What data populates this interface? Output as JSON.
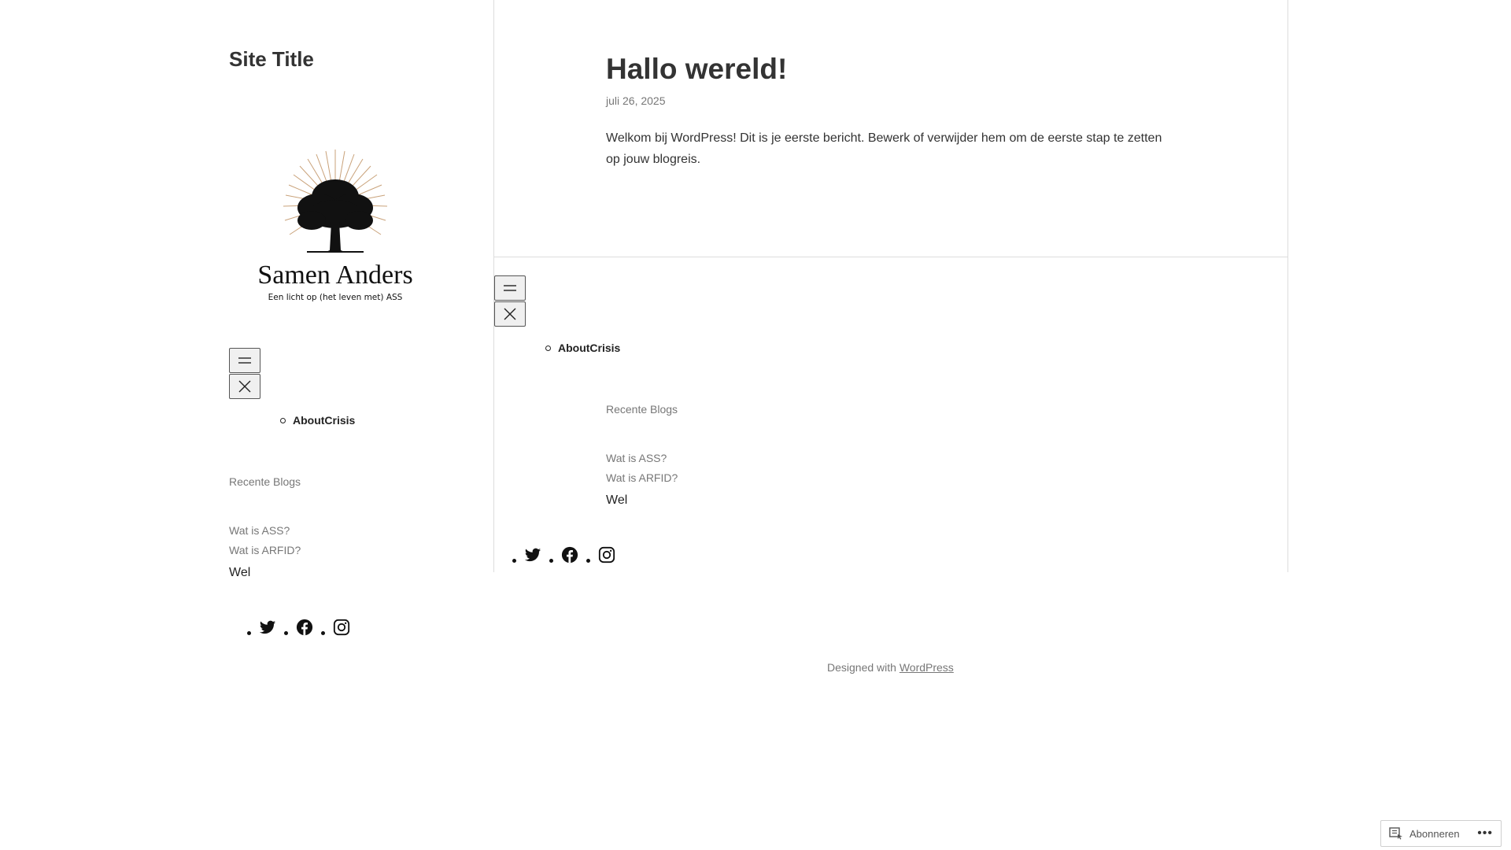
{
  "site": {
    "title": "Site Title"
  },
  "logo": {
    "name": "Samen Anders",
    "tagline": "Een licht op (het leven met) ASS"
  },
  "menu": {
    "open_icon": "hamburger-icon",
    "close_icon": "close-icon",
    "items": [
      {
        "label": "AboutCrisis"
      }
    ]
  },
  "widgets": {
    "recent_title": "Recente Blogs",
    "recent_posts": [
      {
        "label": "Wat is ASS?"
      },
      {
        "label": "Wat is ARFID?"
      }
    ],
    "text": "Wel"
  },
  "social": {
    "icons": [
      "twitter-icon",
      "facebook-icon",
      "instagram-icon"
    ]
  },
  "post": {
    "title": "Hallo wereld!",
    "date": "juli 26, 2025",
    "body": "Welkom bij WordPress! Dit is je eerste bericht. Bewerk of verwijder hem om de eerste stap te zetten op jouw blogreis."
  },
  "footer": {
    "prefix": "Designed with",
    "link": "WordPress"
  },
  "subscribe": {
    "label": "Abonneren",
    "more": "•••"
  },
  "colors": {
    "text": "#333333",
    "muted": "#777777",
    "border": "#dddddd"
  }
}
